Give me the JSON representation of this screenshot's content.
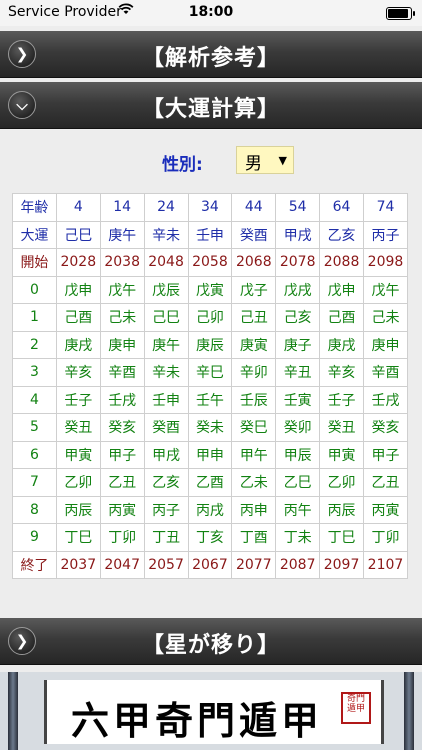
{
  "status_bar": {
    "carrier": "Service Provider",
    "time": "18:00"
  },
  "sections": {
    "analysis": {
      "title": "【解析参考】",
      "icon": "chevron-right"
    },
    "daiun": {
      "title": "【大運計算】",
      "icon": "chevron-down"
    },
    "star_move": {
      "title": "【星が移り】",
      "icon": "chevron-right"
    }
  },
  "gender": {
    "label": "性別:",
    "value": "男",
    "arrow": "▼"
  },
  "table": {
    "age_row": {
      "label": "年齢",
      "values": [
        "4",
        "14",
        "24",
        "34",
        "44",
        "54",
        "64",
        "74"
      ]
    },
    "daiun_row": {
      "label": "大運",
      "values": [
        "己巳",
        "庚午",
        "辛未",
        "壬申",
        "癸酉",
        "甲戌",
        "乙亥",
        "丙子"
      ]
    },
    "start_row": {
      "label": "開始",
      "values": [
        "2028",
        "2038",
        "2048",
        "2058",
        "2068",
        "2078",
        "2088",
        "2098"
      ]
    },
    "year_rows": [
      {
        "label": "0",
        "values": [
          "戊申",
          "戊午",
          "戊辰",
          "戊寅",
          "戊子",
          "戊戌",
          "戊申",
          "戊午"
        ]
      },
      {
        "label": "1",
        "values": [
          "己酉",
          "己未",
          "己巳",
          "己卯",
          "己丑",
          "己亥",
          "己酉",
          "己未"
        ]
      },
      {
        "label": "2",
        "values": [
          "庚戌",
          "庚申",
          "庚午",
          "庚辰",
          "庚寅",
          "庚子",
          "庚戌",
          "庚申"
        ]
      },
      {
        "label": "3",
        "values": [
          "辛亥",
          "辛酉",
          "辛未",
          "辛巳",
          "辛卯",
          "辛丑",
          "辛亥",
          "辛酉"
        ]
      },
      {
        "label": "4",
        "values": [
          "壬子",
          "壬戌",
          "壬申",
          "壬午",
          "壬辰",
          "壬寅",
          "壬子",
          "壬戌"
        ]
      },
      {
        "label": "5",
        "values": [
          "癸丑",
          "癸亥",
          "癸酉",
          "癸未",
          "癸巳",
          "癸卯",
          "癸丑",
          "癸亥"
        ]
      },
      {
        "label": "6",
        "values": [
          "甲寅",
          "甲子",
          "甲戌",
          "甲申",
          "甲午",
          "甲辰",
          "甲寅",
          "甲子"
        ]
      },
      {
        "label": "7",
        "values": [
          "乙卯",
          "乙丑",
          "乙亥",
          "乙酉",
          "乙未",
          "乙巳",
          "乙卯",
          "乙丑"
        ]
      },
      {
        "label": "8",
        "values": [
          "丙辰",
          "丙寅",
          "丙子",
          "丙戌",
          "丙申",
          "丙午",
          "丙辰",
          "丙寅"
        ]
      },
      {
        "label": "9",
        "values": [
          "丁巳",
          "丁卯",
          "丁丑",
          "丁亥",
          "丁酉",
          "丁未",
          "丁巳",
          "丁卯"
        ]
      }
    ],
    "end_row": {
      "label": "終了",
      "values": [
        "2037",
        "2047",
        "2057",
        "2067",
        "2077",
        "2087",
        "2097",
        "2107"
      ]
    }
  },
  "banner": {
    "text": "六甲奇門遁甲",
    "seal": "奇門遁甲"
  },
  "colors": {
    "header_text": "#1f2ea8",
    "start_end": "#8a1818",
    "year_cells": "#128212",
    "select_bg": "#fff8c0"
  }
}
